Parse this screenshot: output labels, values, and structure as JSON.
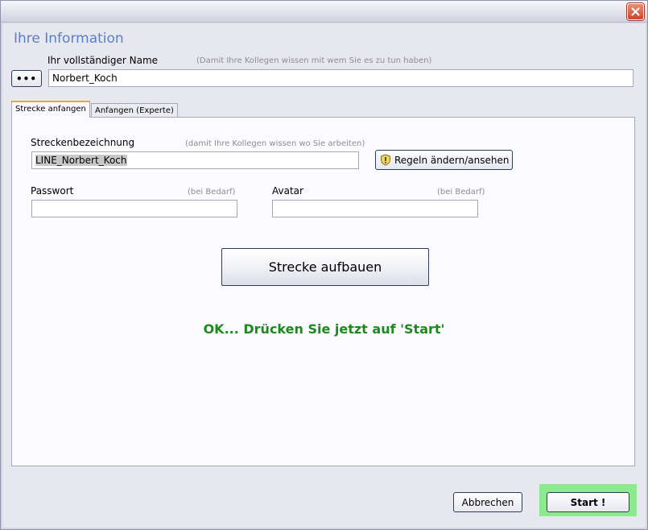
{
  "window": {
    "close_icon": "close-icon"
  },
  "section": {
    "title": "Ihre Information"
  },
  "name_field": {
    "label": "Ihr vollständiger Name",
    "hint": "(Damit Ihre Kollegen wissen mit wem Sie es zu tun haben)",
    "value": "Norbert_Koch",
    "browse_label": "•••"
  },
  "tabs": [
    {
      "label": "Strecke anfangen",
      "active": true
    },
    {
      "label": "Anfangen (Experte)",
      "active": false
    }
  ],
  "line_field": {
    "label": "Streckenbezeichnung",
    "hint": "(damit Ihre Kollegen wissen wo Sie arbeiten)",
    "value": "LINE_Norbert_Koch"
  },
  "rules_button": {
    "label": "Regeln ändern/ansehen",
    "icon": "shield-icon"
  },
  "password_field": {
    "label": "Passwort",
    "hint": "(bei Bedarf)",
    "value": ""
  },
  "avatar_field": {
    "label": "Avatar",
    "hint": "(bei Bedarf)",
    "value": ""
  },
  "build_button": {
    "label": "Strecke aufbauen"
  },
  "status_message": "OK... Drücken Sie jetzt auf 'Start'",
  "footer": {
    "cancel_label": "Abbrechen",
    "start_label": "Start !"
  },
  "colors": {
    "title": "#5b7fc6",
    "status": "#1d8a1d",
    "start_highlight": "#8de98d",
    "close_button": "#c8462c"
  }
}
